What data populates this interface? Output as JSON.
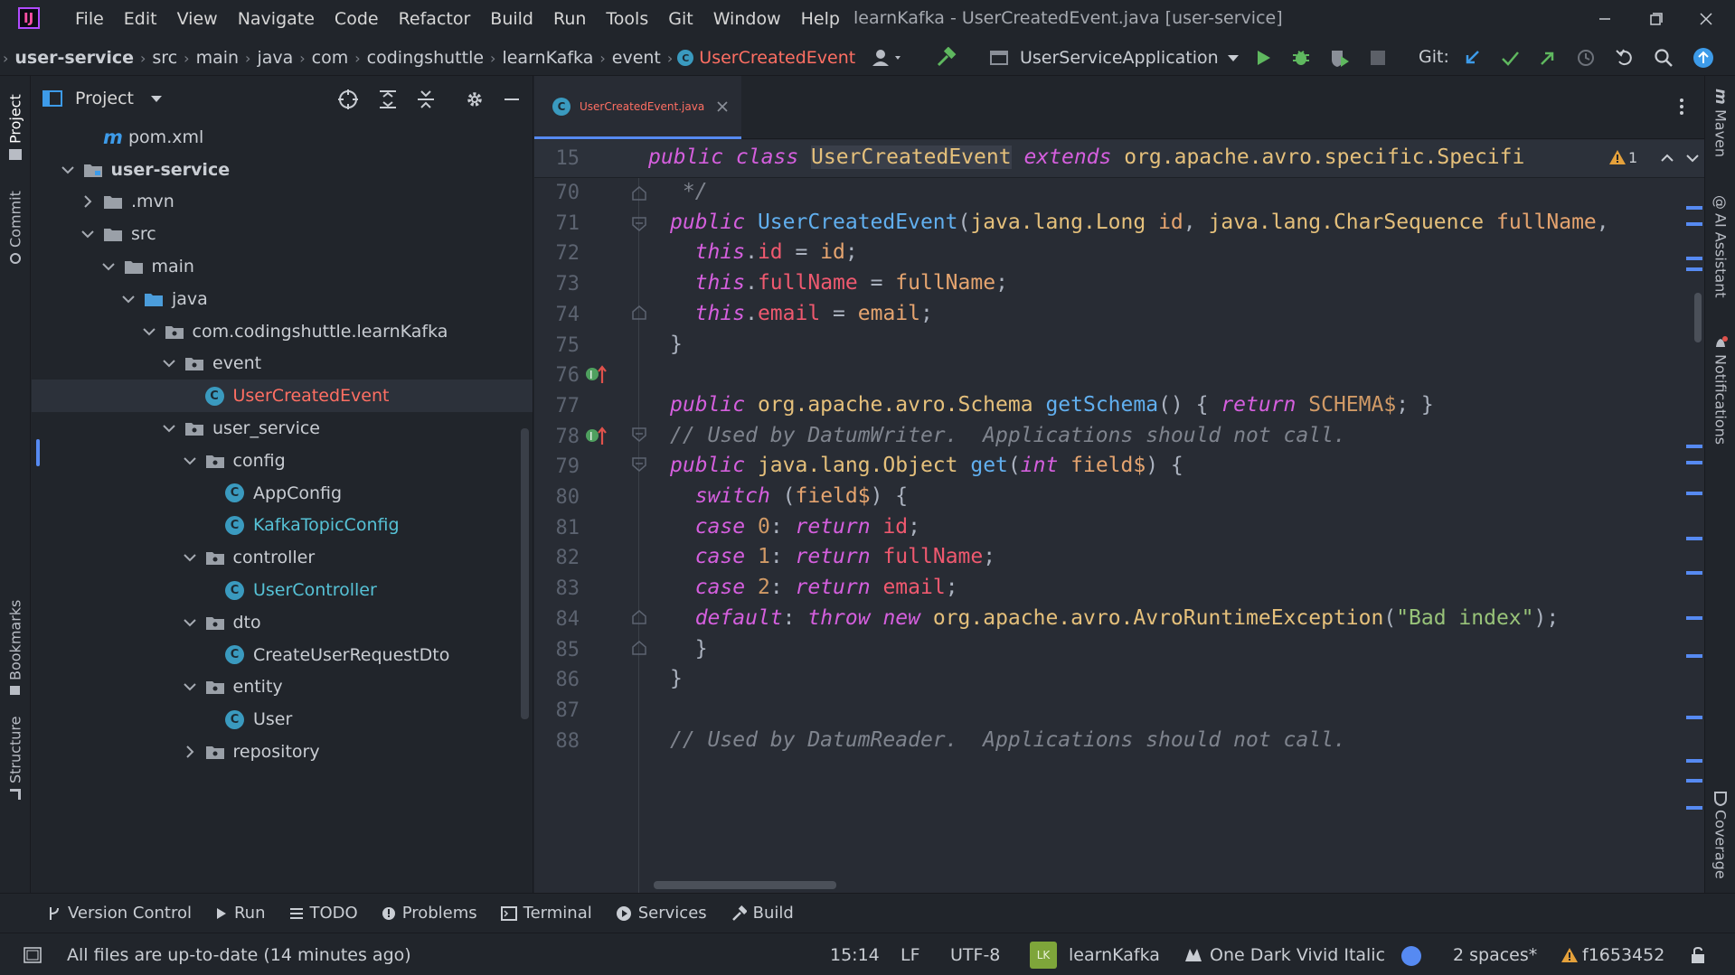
{
  "menubar": {
    "items": [
      "File",
      "Edit",
      "View",
      "Navigate",
      "Code",
      "Refactor",
      "Build",
      "Run",
      "Tools",
      "Git",
      "Window",
      "Help"
    ],
    "window_title": "learnKafka - UserCreatedEvent.java [user-service]"
  },
  "navbar": {
    "breadcrumbs": [
      "user-service",
      "src",
      "main",
      "java",
      "com",
      "codingshuttle",
      "learnKafka",
      "event",
      "UserCreatedEvent"
    ],
    "run_config": "UserServiceApplication",
    "git_label": "Git:"
  },
  "left_stripe": {
    "project": "Project",
    "commit": "Commit",
    "bookmarks": "Bookmarks",
    "structure": "Structure"
  },
  "right_stripe": {
    "maven": "Maven",
    "ai": "AI Assistant",
    "notifications": "Notifications",
    "coverage": "Coverage"
  },
  "project_panel": {
    "title": "Project",
    "tree": [
      {
        "label": "pom.xml",
        "depth": 2,
        "kind": "maven"
      },
      {
        "label": "user-service",
        "depth": 1,
        "kind": "module",
        "open": true,
        "bold": true
      },
      {
        "label": ".mvn",
        "depth": 2,
        "kind": "folder",
        "open": false
      },
      {
        "label": "src",
        "depth": 2,
        "kind": "folder",
        "open": true
      },
      {
        "label": "main",
        "depth": 3,
        "kind": "folder",
        "open": true
      },
      {
        "label": "java",
        "depth": 4,
        "kind": "srcfolder",
        "open": true
      },
      {
        "label": "com.codingshuttle.learnKafka",
        "depth": 5,
        "kind": "package",
        "open": true
      },
      {
        "label": "event",
        "depth": 6,
        "kind": "package",
        "open": true
      },
      {
        "label": "UserCreatedEvent",
        "depth": 7,
        "kind": "class",
        "active": true
      },
      {
        "label": "user_service",
        "depth": 6,
        "kind": "package",
        "open": true
      },
      {
        "label": "config",
        "depth": 7,
        "kind": "package",
        "open": true
      },
      {
        "label": "AppConfig",
        "depth": 8,
        "kind": "class"
      },
      {
        "label": "KafkaTopicConfig",
        "depth": 8,
        "kind": "class",
        "cls": true
      },
      {
        "label": "controller",
        "depth": 7,
        "kind": "package",
        "open": true
      },
      {
        "label": "UserController",
        "depth": 8,
        "kind": "class",
        "cls": true
      },
      {
        "label": "dto",
        "depth": 7,
        "kind": "package",
        "open": true
      },
      {
        "label": "CreateUserRequestDto",
        "depth": 8,
        "kind": "class"
      },
      {
        "label": "entity",
        "depth": 7,
        "kind": "package",
        "open": true
      },
      {
        "label": "User",
        "depth": 8,
        "kind": "class"
      },
      {
        "label": "repository",
        "depth": 7,
        "kind": "package",
        "open": false
      }
    ]
  },
  "editor": {
    "tab_label": "UserCreatedEvent.java",
    "sticky_line_number": "15",
    "warning_count": "1",
    "lines": [
      {
        "n": "70",
        "tokens": [
          [
            "cm",
            " */"
          ]
        ]
      },
      {
        "n": "71",
        "tokens": [
          [
            "kw",
            "public "
          ],
          [
            "fn",
            "UserCreatedEvent"
          ],
          [
            "",
            "("
          ],
          [
            "ty",
            "java.lang.Long "
          ],
          [
            "par",
            "id"
          ],
          [
            "",
            ", "
          ],
          [
            "ty",
            "java.lang.CharSequence "
          ],
          [
            "par",
            "fullName"
          ],
          [
            "",
            ","
          ]
        ]
      },
      {
        "n": "72",
        "tokens": [
          [
            "",
            "  "
          ],
          [
            "kw",
            "this"
          ],
          [
            "",
            "."
          ],
          [
            "fld",
            "id"
          ],
          [
            "",
            " = "
          ],
          [
            "par",
            "id"
          ],
          [
            "",
            ";"
          ]
        ]
      },
      {
        "n": "73",
        "tokens": [
          [
            "",
            "  "
          ],
          [
            "kw",
            "this"
          ],
          [
            "",
            "."
          ],
          [
            "fld",
            "fullName"
          ],
          [
            "",
            " = "
          ],
          [
            "par",
            "fullName"
          ],
          [
            "",
            ";"
          ]
        ]
      },
      {
        "n": "74",
        "tokens": [
          [
            "",
            "  "
          ],
          [
            "kw",
            "this"
          ],
          [
            "",
            "."
          ],
          [
            "fld",
            "email"
          ],
          [
            "",
            " = "
          ],
          [
            "par",
            "email"
          ],
          [
            "",
            ";"
          ]
        ]
      },
      {
        "n": "75",
        "tokens": [
          [
            "",
            "}"
          ]
        ]
      },
      {
        "n": "76",
        "tokens": []
      },
      {
        "n": "77",
        "tokens": [
          [
            "kw",
            "public "
          ],
          [
            "ty",
            "org.apache.avro.Schema "
          ],
          [
            "fn",
            "getSchema"
          ],
          [
            "",
            "() { "
          ],
          [
            "kw",
            "return "
          ],
          [
            "nm",
            "SCHEMA$"
          ],
          [
            "",
            "; }"
          ]
        ]
      },
      {
        "n": "78",
        "tokens": [
          [
            "cm",
            "// Used by DatumWriter.  Applications should not call."
          ]
        ]
      },
      {
        "n": "79",
        "tokens": [
          [
            "kw",
            "public "
          ],
          [
            "ty",
            "java.lang.Object "
          ],
          [
            "fn",
            "get"
          ],
          [
            "",
            "("
          ],
          [
            "kw",
            "int "
          ],
          [
            "par",
            "field$"
          ],
          [
            "",
            ") {"
          ]
        ]
      },
      {
        "n": "80",
        "tokens": [
          [
            "",
            "  "
          ],
          [
            "kw",
            "switch"
          ],
          [
            "",
            " ("
          ],
          [
            "par",
            "field$"
          ],
          [
            "",
            ") {"
          ]
        ]
      },
      {
        "n": "81",
        "tokens": [
          [
            "",
            "  "
          ],
          [
            "kw",
            "case "
          ],
          [
            "nm",
            "0"
          ],
          [
            "",
            ": "
          ],
          [
            "kw",
            "return "
          ],
          [
            "fld",
            "id"
          ],
          [
            "",
            ";"
          ]
        ]
      },
      {
        "n": "82",
        "tokens": [
          [
            "",
            "  "
          ],
          [
            "kw",
            "case "
          ],
          [
            "nm",
            "1"
          ],
          [
            "",
            ": "
          ],
          [
            "kw",
            "return "
          ],
          [
            "fld",
            "fullName"
          ],
          [
            "",
            ";"
          ]
        ]
      },
      {
        "n": "83",
        "tokens": [
          [
            "",
            "  "
          ],
          [
            "kw",
            "case "
          ],
          [
            "nm",
            "2"
          ],
          [
            "",
            ": "
          ],
          [
            "kw",
            "return "
          ],
          [
            "fld",
            "email"
          ],
          [
            "",
            ";"
          ]
        ]
      },
      {
        "n": "84",
        "tokens": [
          [
            "",
            "  "
          ],
          [
            "kw",
            "default"
          ],
          [
            "",
            ": "
          ],
          [
            "kw",
            "throw "
          ],
          [
            "kw",
            "new "
          ],
          [
            "ty",
            "org.apache.avro.AvroRuntimeException"
          ],
          [
            "",
            "("
          ],
          [
            "st",
            "\"Bad index\""
          ],
          [
            "",
            ");"
          ]
        ]
      },
      {
        "n": "85",
        "tokens": [
          [
            "",
            "  }"
          ]
        ]
      },
      {
        "n": "86",
        "tokens": [
          [
            "",
            "}"
          ]
        ]
      },
      {
        "n": "87",
        "tokens": []
      },
      {
        "n": "88",
        "tokens": [
          [
            "cm",
            "// Used by DatumReader.  Applications should not call."
          ]
        ]
      }
    ]
  },
  "tool_windows": [
    "Version Control",
    "Run",
    "TODO",
    "Problems",
    "Terminal",
    "Services",
    "Build"
  ],
  "status": {
    "message": "All files are up-to-date (14 minutes ago)",
    "position": "15:14",
    "line_sep": "LF",
    "encoding": "UTF-8",
    "project_badge": "LK",
    "project": "learnKafka",
    "theme": "One Dark Vivid Italic",
    "indent": "2 spaces*",
    "commit": "f1653452"
  },
  "colors": {
    "accent": "#568af2",
    "active_file": "#ff6f63",
    "class_icon": "#3a9abf"
  }
}
